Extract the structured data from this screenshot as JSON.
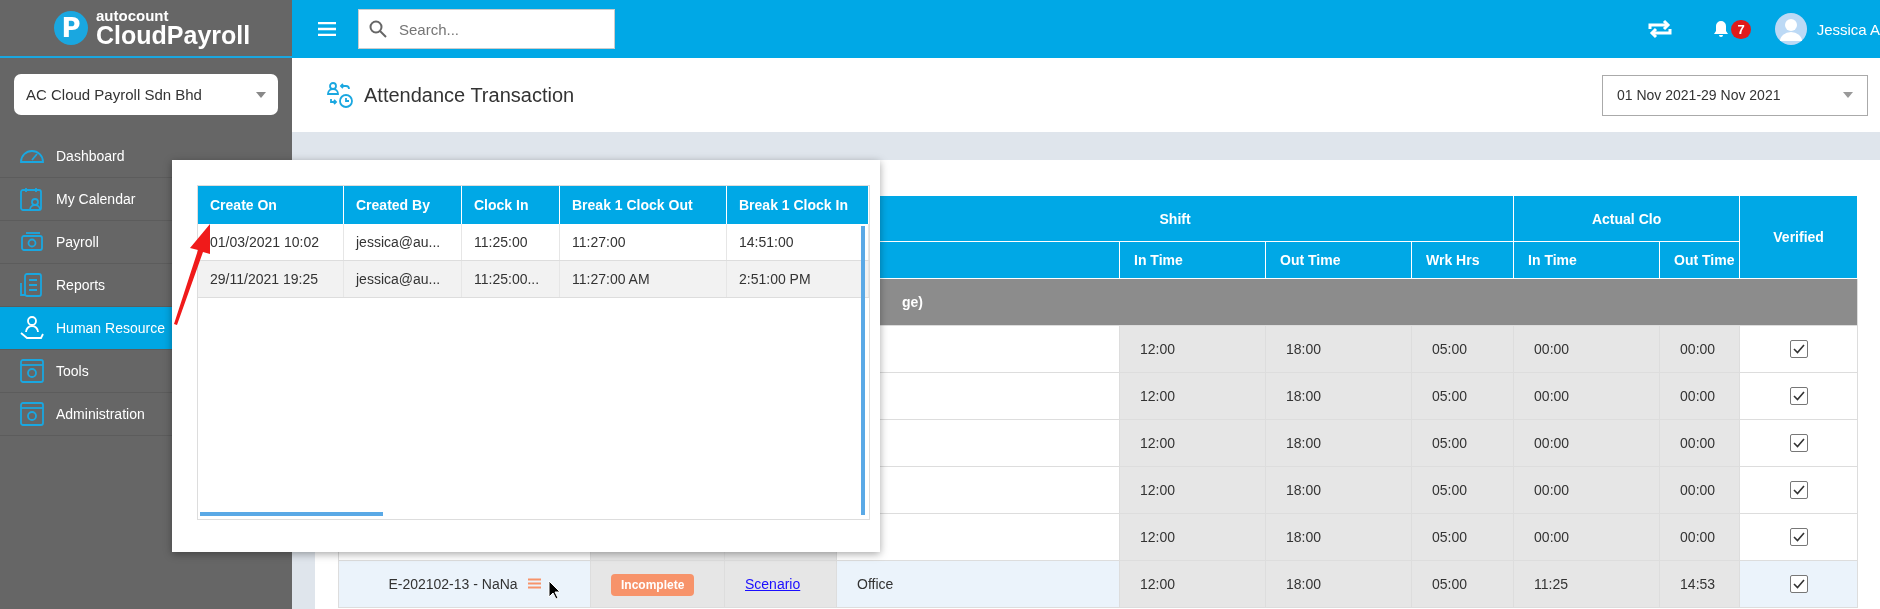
{
  "logo": {
    "mark": "P",
    "small": "autocount",
    "main": "CloudPayroll"
  },
  "company_select": {
    "value": "AC Cloud Payroll Sdn Bhd"
  },
  "sidebar": {
    "items": [
      {
        "label": "Dashboard",
        "selected": false
      },
      {
        "label": "My Calendar",
        "selected": false
      },
      {
        "label": "Payroll",
        "selected": false
      },
      {
        "label": "Reports",
        "selected": false
      },
      {
        "label": "Human Resource",
        "selected": true
      },
      {
        "label": "Tools",
        "selected": false
      },
      {
        "label": "Administration",
        "selected": false
      }
    ]
  },
  "topbar": {
    "search": {
      "placeholder": "Search..."
    },
    "notification_count": "7",
    "user": "Jessica A"
  },
  "page": {
    "title": "Attendance Transaction",
    "date_range": "01 Nov 2021-29 Nov 2021"
  },
  "table": {
    "group_headers": [
      "Shift",
      "Actual Clo"
    ],
    "verified_header": "Verified",
    "sub_headers": [
      "In Time",
      "Out Time",
      "Wrk Hrs",
      "In Time",
      "Out Time"
    ],
    "group_row": "ge)",
    "rows": [
      {
        "shift_in": "12:00",
        "shift_out": "18:00",
        "wrk_hrs": "05:00",
        "actual_in": "00:00",
        "actual_out": "00:00",
        "verified": true,
        "selected": false
      },
      {
        "shift_in": "12:00",
        "shift_out": "18:00",
        "wrk_hrs": "05:00",
        "actual_in": "00:00",
        "actual_out": "00:00",
        "verified": true,
        "selected": false
      },
      {
        "shift_in": "12:00",
        "shift_out": "18:00",
        "wrk_hrs": "05:00",
        "actual_in": "00:00",
        "actual_out": "00:00",
        "verified": true,
        "selected": false
      },
      {
        "shift_in": "12:00",
        "shift_out": "18:00",
        "wrk_hrs": "05:00",
        "actual_in": "00:00",
        "actual_out": "00:00",
        "verified": true,
        "selected": false
      },
      {
        "shift_in": "12:00",
        "shift_out": "18:00",
        "wrk_hrs": "05:00",
        "actual_in": "00:00",
        "actual_out": "00:00",
        "verified": true,
        "selected": false
      },
      {
        "name": "E-202102-13 - NaNa",
        "status": {
          "label": "Incomplete",
          "color": "#f7936a"
        },
        "scenario": "Scenario",
        "location": "Office",
        "shift_in": "12:00",
        "shift_out": "18:00",
        "wrk_hrs": "05:00",
        "actual_in": "11:25",
        "actual_out": "14:53",
        "verified": true,
        "selected": true
      }
    ]
  },
  "popup": {
    "columns": [
      "Create On",
      "Created By",
      "Clock In",
      "Break 1 Clock Out",
      "Break 1 Clock In"
    ],
    "rows": [
      [
        "01/03/2021 10:02",
        "jessica@au...",
        "11:25:00",
        "11:27:00",
        "14:51:00"
      ],
      [
        "29/11/2021 19:25",
        "jessica@au...",
        "11:25:00...",
        "11:27:00 AM",
        "2:51:00 PM"
      ]
    ]
  }
}
